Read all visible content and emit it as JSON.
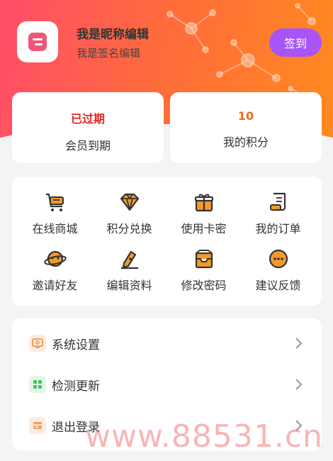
{
  "profile": {
    "nickname": "我是昵称编辑",
    "signature": "我是签名编辑",
    "signin_label": "签到"
  },
  "stats": [
    {
      "value": "已过期",
      "label": "会员到期"
    },
    {
      "value": "10",
      "label": "我的积分"
    }
  ],
  "grid": [
    {
      "label": "在线商城",
      "icon": "shopping-cart-icon"
    },
    {
      "label": "积分兑换",
      "icon": "diamond-icon"
    },
    {
      "label": "使用卡密",
      "icon": "gift-icon"
    },
    {
      "label": "我的订单",
      "icon": "receipt-icon"
    },
    {
      "label": "邀请好友",
      "icon": "planet-icon"
    },
    {
      "label": "编辑资料",
      "icon": "pen-edit-icon"
    },
    {
      "label": "修改密码",
      "icon": "inbox-icon"
    },
    {
      "label": "建议反馈",
      "icon": "chat-bubble-icon"
    }
  ],
  "menu": [
    {
      "label": "系统设置",
      "icon": "settings-icon"
    },
    {
      "label": "检测更新",
      "icon": "grid-apps-icon"
    },
    {
      "label": "退出登录",
      "icon": "logout-icon"
    }
  ],
  "watermark": "www.88531.cn",
  "colors": {
    "header_start": "#ff4d6a",
    "header_end": "#ff8a1f",
    "signin_bg": "#a855f7",
    "expired": "#e02424",
    "points": "#f26b1d",
    "icon_orange": "#f59a2a"
  }
}
